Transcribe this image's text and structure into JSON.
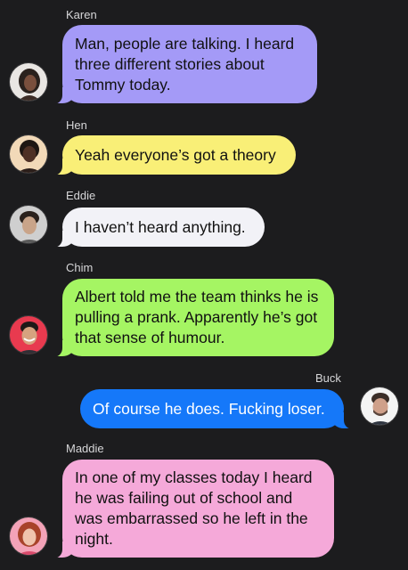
{
  "colors": {
    "background": "#1c1c1e",
    "karen_bubble": "#a49af7",
    "hen_bubble": "#f9ef77",
    "eddie_bubble": "#f2f2f7",
    "chim_bubble": "#a5f563",
    "buck_bubble": "#1578f9",
    "maddie_bubble": "#f5a9d9"
  },
  "messages": [
    {
      "sender": "Karen",
      "text": "Man, people are talking. I heard three different stories about Tommy today.",
      "avatar_icon": "karen-avatar-icon"
    },
    {
      "sender": "Hen",
      "text": "Yeah everyone’s got a theory",
      "avatar_icon": "hen-avatar-icon"
    },
    {
      "sender": "Eddie",
      "text": "I haven’t heard anything.",
      "avatar_icon": "eddie-avatar-icon"
    },
    {
      "sender": "Chim",
      "text": "Albert told me the team thinks he is pulling a prank. Apparently he’s got that sense of humour.",
      "avatar_icon": "chim-avatar-icon"
    },
    {
      "sender": "Buck",
      "text": "Of course he does. Fucking loser.",
      "avatar_icon": "buck-avatar-icon"
    },
    {
      "sender": "Maddie",
      "text": "In one of my classes today I heard he was failing out of school and was embarrassed so he left in the night.",
      "avatar_icon": "maddie-avatar-icon"
    }
  ]
}
